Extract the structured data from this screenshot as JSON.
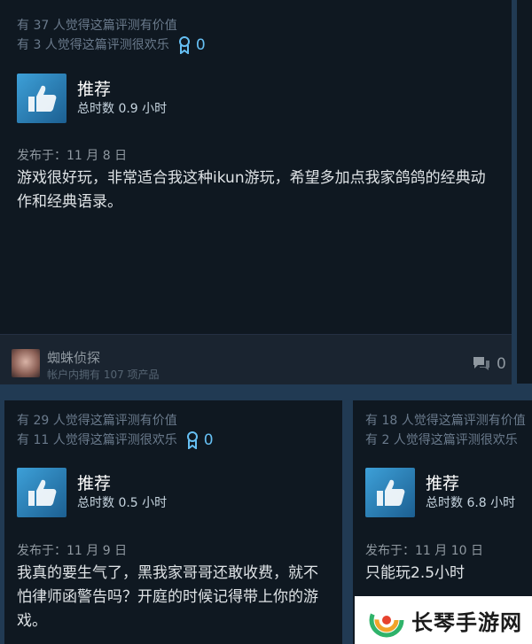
{
  "reviews": [
    {
      "helpful": "有 37 人觉得这篇评测有价值",
      "funny": "有 3 人觉得这篇评测很欢乐",
      "awards": "0",
      "recommendation": "推荐",
      "hours": "总时数 0.9 小时",
      "posted": "发布于：11 月 8 日",
      "text_lines": [
        "游戏很好玩，非常适合我这种ikun游玩，希望多加点我家鸽鸽的经典动",
        "作和经典语录。"
      ],
      "username": "蜘蛛侦探",
      "owned": "帐户内拥有 107 项产品",
      "comments": "0"
    },
    {
      "helpful": "有 29 人觉得这篇评测有价值",
      "funny": "有 11 人觉得这篇评测很欢乐",
      "awards": "0",
      "recommendation": "推荐",
      "hours": "总时数 0.5 小时",
      "posted": "发布于：11 月 9 日",
      "text_lines": [
        "我真的要生气了，黑我家哥哥还敢收费，就不",
        "怕律师函警告吗？开庭的时候记得带上你的游",
        "戏。"
      ]
    },
    {
      "helpful": "有 18 人觉得这篇评测有价值",
      "funny": "有 2 人觉得这篇评测很欢乐",
      "recommendation": "推荐",
      "hours": "总时数 6.8 小时",
      "posted": "发布于：11 月 10 日",
      "text_lines": [
        "只能玩2.5小时"
      ]
    }
  ],
  "watermark": {
    "text": "长琴手游网"
  },
  "colors": {
    "accent": "#66c0f4",
    "background": "#213a53",
    "card": "#0f1821"
  }
}
